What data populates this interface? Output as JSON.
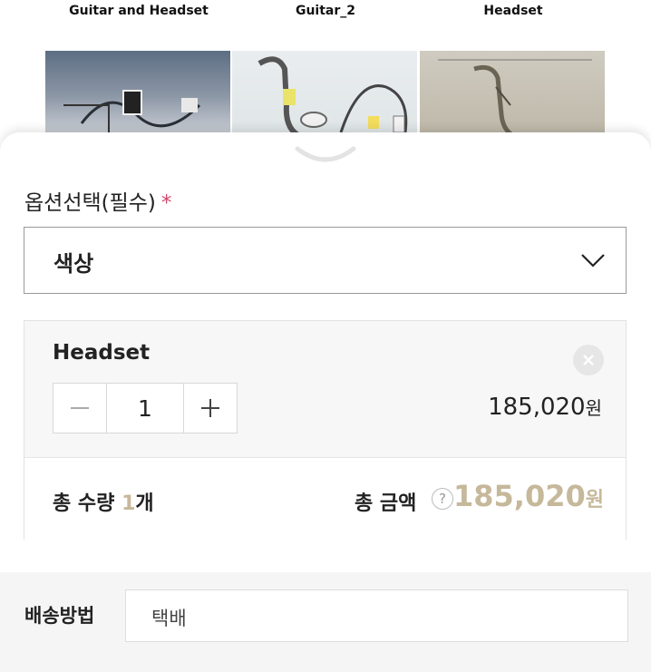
{
  "thumbnails": [
    {
      "label": "Guitar and Headset"
    },
    {
      "label": "Guitar_2"
    },
    {
      "label": "Headset"
    }
  ],
  "options": {
    "title": "옵션선택(필수)",
    "required_marker": "*",
    "select_value": "색상",
    "select_icon": "chevron-down-icon"
  },
  "selected_item": {
    "name": "Headset",
    "quantity": "1",
    "price": "185,020",
    "currency": "원",
    "remove_icon": "close-icon"
  },
  "summary": {
    "total_qty_label": "총 수량",
    "total_qty_count": "1",
    "total_qty_unit": "개",
    "total_amount_label": "총 금액",
    "help_icon_text": "?",
    "total_amount_value": "185,020",
    "currency": "원"
  },
  "delivery": {
    "label": "배송방법",
    "value": "택배"
  },
  "colors": {
    "accent_gold": "#c6b89a",
    "required_star": "#d2476b"
  }
}
